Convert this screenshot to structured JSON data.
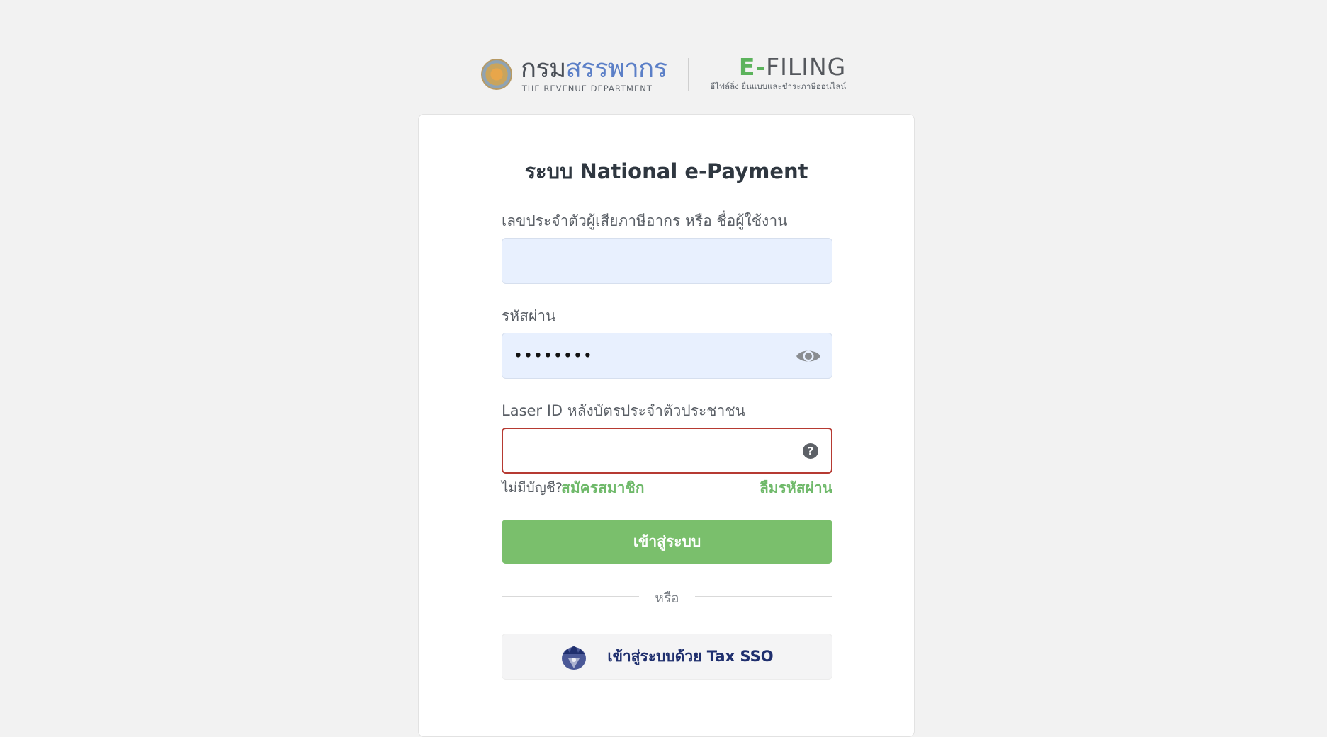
{
  "header": {
    "rd_logo_thai_dark": "กรม",
    "rd_logo_thai_blue": "สรรพากร",
    "rd_logo_english": "THE REVENUE DEPARTMENT",
    "efiling_prefix": "E-",
    "efiling_rest": "FILING",
    "efiling_subtitle": "อีไฟล์ลิ่ง ยื่นแบบและชำระภาษีออนไลน์"
  },
  "login": {
    "title": "ระบบ National e-Payment",
    "username_label": "เลขประจำตัวผู้เสียภาษีอากร หรือ ชื่อผู้ใช้งาน",
    "username_value": "",
    "password_label": "รหัสผ่าน",
    "password_masked": "••••••••",
    "laser_id_label": "Laser ID หลังบัตรประจำตัวประชาชน",
    "laser_id_value": "",
    "help_glyph": "?",
    "no_account_text": "ไม่มีบัญชี?",
    "signup_link": "สมัครสมาชิก",
    "forgot_password_link": "ลืมรหัสผ่าน",
    "login_button": "เข้าสู่ระบบ",
    "or_text": "หรือ",
    "sso_button": "เข้าสู่ระบบด้วย Tax SSO"
  },
  "colors": {
    "accent_green": "#7abf6c",
    "link_green": "#6fb96a",
    "error_border": "#b63a32",
    "field_fill": "#e8f0fe",
    "sso_text": "#1f2f6e"
  },
  "icons": {
    "seal": "revenue-department-seal-icon",
    "eye": "eye-icon",
    "help": "help-circle-icon",
    "sso": "garuda-emblem-icon"
  }
}
